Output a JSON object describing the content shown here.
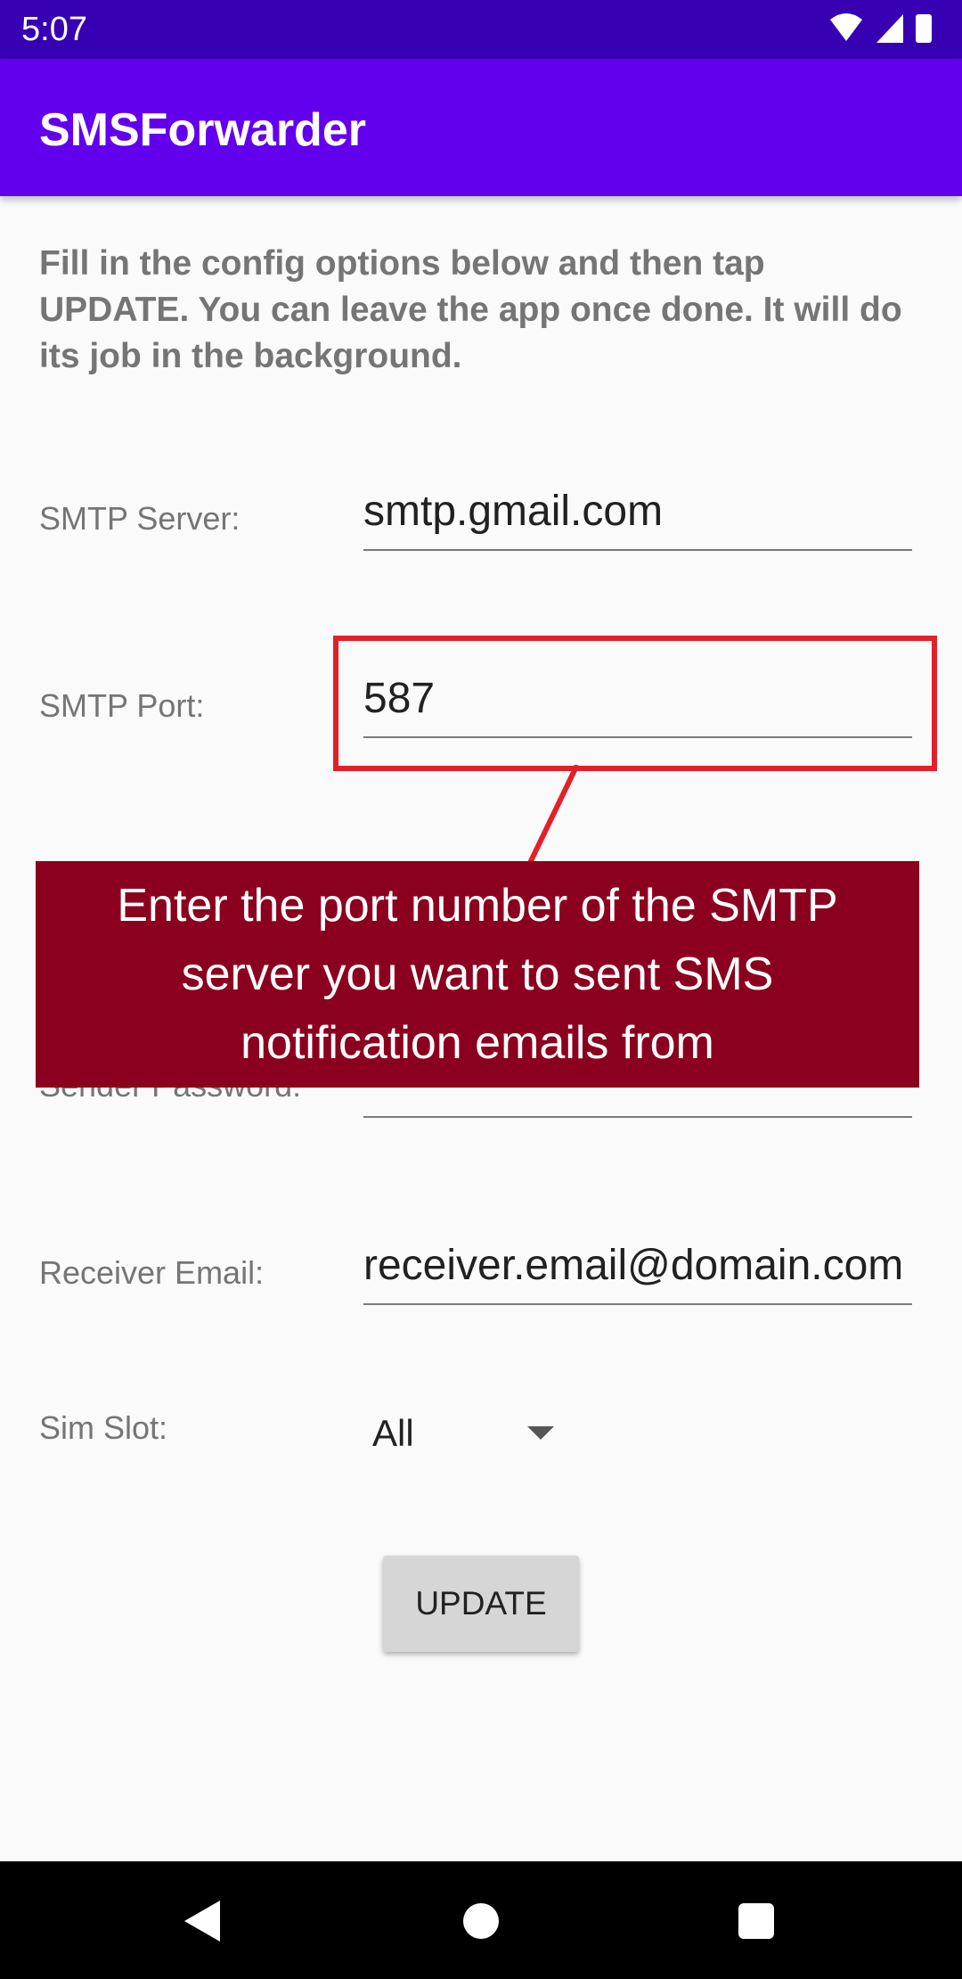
{
  "status_bar": {
    "time": "5:07",
    "icons": [
      "wifi-icon",
      "cellular-signal-icon",
      "battery-icon"
    ]
  },
  "app_bar": {
    "title": "SMSForwarder"
  },
  "intro_text": "Fill in the config options below and then tap UPDATE. You can leave the app once done. It will do its job in the background.",
  "form": {
    "smtp_server": {
      "label": "SMTP Server:",
      "value": "smtp.gmail.com"
    },
    "smtp_port": {
      "label": "SMTP Port:",
      "value": "587"
    },
    "sender_password": {
      "label": "Sender Password:",
      "value": ""
    },
    "receiver_email": {
      "label": "Receiver Email:",
      "value": "receiver.email@domain.com"
    },
    "sim_slot": {
      "label": "Sim Slot:",
      "selected": "All"
    }
  },
  "update_button": {
    "label": "UPDATE"
  },
  "tooltip": {
    "text": "Enter the port number of the SMTP server you want to sent SMS notification emails from"
  },
  "colors": {
    "status_bar": "#3700b3",
    "app_bar": "#6200ee",
    "highlight": "#e3202a",
    "tooltip_bg": "#8b001e"
  },
  "nav_bar": {
    "icons": [
      "back-icon",
      "home-icon",
      "recents-icon"
    ]
  }
}
